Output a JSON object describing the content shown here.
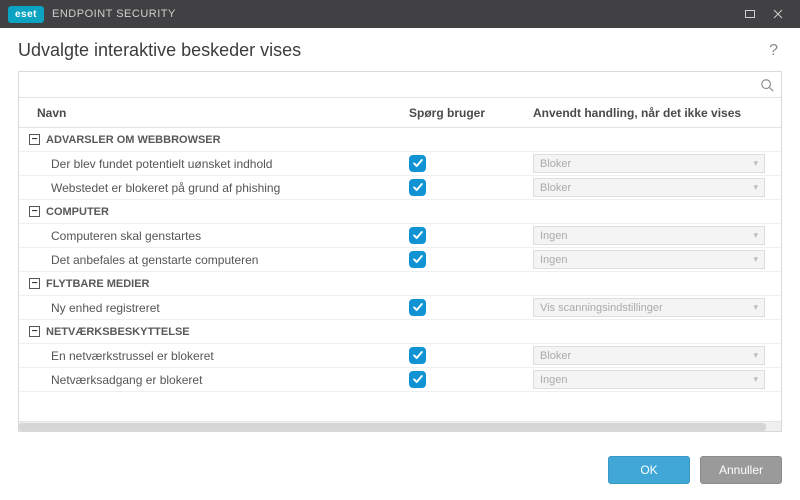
{
  "titlebar": {
    "brand_badge": "eset",
    "brand_text": "ENDPOINT SECURITY"
  },
  "header": {
    "title": "Udvalgte interaktive beskeder vises",
    "help": "?"
  },
  "search": {
    "placeholder": ""
  },
  "columns": {
    "name": "Navn",
    "ask": "Spørg bruger",
    "action": "Anvendt handling, når det ikke vises"
  },
  "groups": [
    {
      "label": "ADVARSLER OM WEBBROWSER",
      "items": [
        {
          "label": "Der blev fundet potentielt uønsket indhold",
          "checked": true,
          "action": "Bloker"
        },
        {
          "label": "Webstedet er blokeret på grund af phishing",
          "checked": true,
          "action": "Bloker"
        }
      ]
    },
    {
      "label": "COMPUTER",
      "items": [
        {
          "label": "Computeren skal genstartes",
          "checked": true,
          "action": "Ingen"
        },
        {
          "label": "Det anbefales at genstarte computeren",
          "checked": true,
          "action": "Ingen"
        }
      ]
    },
    {
      "label": "FLYTBARE MEDIER",
      "items": [
        {
          "label": "Ny enhed registreret",
          "checked": true,
          "action": "Vis scanningsindstillinger"
        }
      ]
    },
    {
      "label": "NETVÆRKSBESKYTTELSE",
      "items": [
        {
          "label": "En netværkstrussel er blokeret",
          "checked": true,
          "action": "Bloker"
        },
        {
          "label": "Netværksadgang er blokeret",
          "checked": true,
          "action": "Ingen"
        }
      ]
    }
  ],
  "footer": {
    "ok": "OK",
    "cancel": "Annuller"
  }
}
